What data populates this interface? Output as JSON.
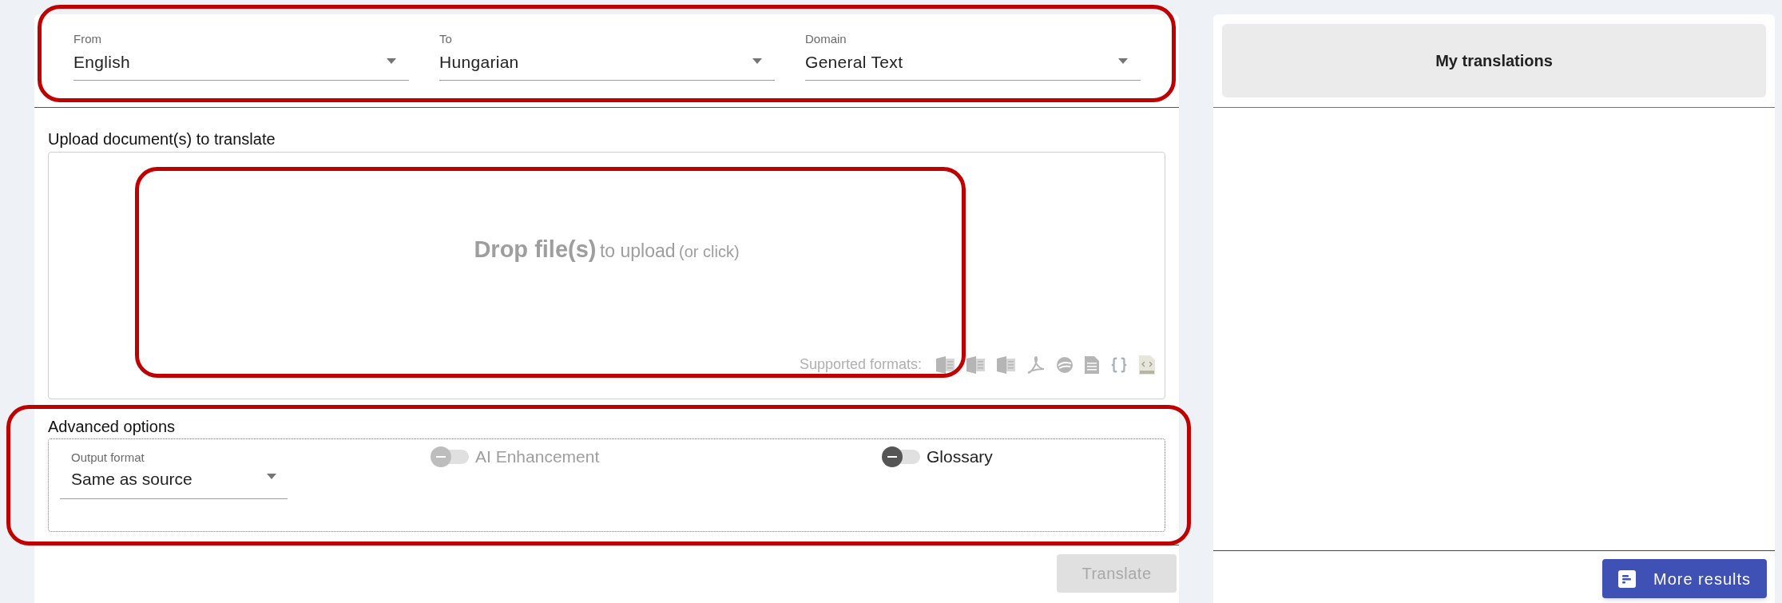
{
  "language_bar": {
    "highlighted": true,
    "selects": [
      {
        "label": "From",
        "value": "English"
      },
      {
        "label": "To",
        "value": "Hungarian"
      },
      {
        "label": "Domain",
        "value": "General Text"
      }
    ]
  },
  "upload": {
    "title": "Upload document(s) to translate",
    "dropzone": {
      "highlighted": true,
      "strong": "Drop file(s)",
      "text": "to upload",
      "hint": "(or click)"
    },
    "supported_label": "Supported formats:",
    "formats": [
      {
        "kind": "word"
      },
      {
        "kind": "excel"
      },
      {
        "kind": "powerpoint"
      },
      {
        "kind": "pdf"
      },
      {
        "kind": "openoffice"
      },
      {
        "kind": "text"
      },
      {
        "kind": "json"
      },
      {
        "kind": "html"
      }
    ]
  },
  "advanced": {
    "highlighted": true,
    "title": "Advanced options",
    "output_format": {
      "label": "Output format",
      "value": "Same as source"
    },
    "toggles": [
      {
        "label": "AI Enhancement",
        "on": false,
        "disabled": true
      },
      {
        "label": "Glossary",
        "on": false,
        "disabled": false
      }
    ]
  },
  "translate_button": {
    "label": "Translate",
    "disabled": true
  },
  "side": {
    "title": "My translations",
    "more_button": "More results"
  }
}
